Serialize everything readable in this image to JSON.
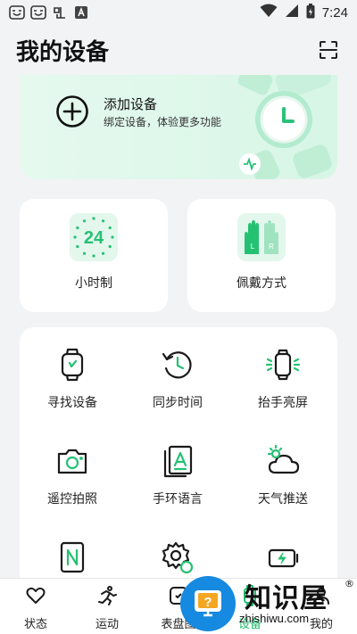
{
  "status_bar": {
    "time": "7:24",
    "left_icons": [
      "emoji-face-icon",
      "emoji-face-icon",
      "app-icon",
      "a-icon"
    ],
    "right_icons": [
      "wifi-icon",
      "signal-icon",
      "battery-icon"
    ]
  },
  "header": {
    "title": "我的设备",
    "scan_icon": "scan-icon"
  },
  "add_device": {
    "title": "添加设备",
    "subtitle": "绑定设备，体验更多功能"
  },
  "features": [
    {
      "label": "小时制",
      "icon": "24-hour-icon",
      "icon_text": "24"
    },
    {
      "label": "佩戴方式",
      "icon": "hands-lr-icon",
      "left": "L",
      "right": "R"
    }
  ],
  "grid": [
    {
      "label": "寻找设备",
      "icon": "watch-find-icon"
    },
    {
      "label": "同步时间",
      "icon": "sync-time-icon"
    },
    {
      "label": "抬手亮屏",
      "icon": "raise-wake-icon"
    },
    {
      "label": "遥控拍照",
      "icon": "camera-icon"
    },
    {
      "label": "手环语言",
      "icon": "language-icon"
    },
    {
      "label": "天气推送",
      "icon": "weather-icon"
    },
    {
      "label": "",
      "icon": "nfc-icon"
    },
    {
      "label": "",
      "icon": "settings-icon"
    },
    {
      "label": "",
      "icon": "battery-charge-icon"
    }
  ],
  "tabs": [
    {
      "label": "状态",
      "icon": "heart-icon"
    },
    {
      "label": "运动",
      "icon": "running-icon"
    },
    {
      "label": "表盘图",
      "icon": "watchface-icon"
    },
    {
      "label": "设备",
      "icon": "device-icon"
    },
    {
      "label": "我的",
      "icon": "profile-icon"
    }
  ],
  "watermark": {
    "brand": "知识屋",
    "url": "zhishiwu.com",
    "reg": "®"
  },
  "colors": {
    "accent": "#1fbf6d",
    "card_tint": "#e3f7ed",
    "background": "#f2f3f5"
  }
}
